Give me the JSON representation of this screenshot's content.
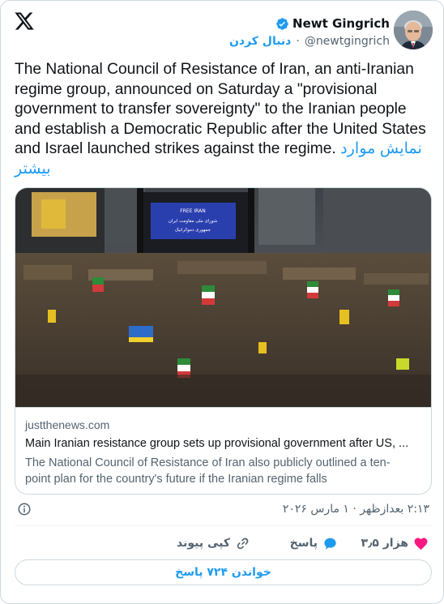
{
  "author": {
    "display_name": "Newt Gingrich",
    "handle": "@newtgingrich",
    "separator": "·",
    "follow_label": "دنبال کردن",
    "verified": true
  },
  "tweet": {
    "text": "The National Council of Resistance of Iran, an anti-Iranian regime group, announced on Saturday a \"provisional government to transfer sovereignty\" to the Iranian people and establish a Democratic Republic after the United States and Israel launched strikes against the regime.",
    "show_more": "نمایش موارد بیشتر"
  },
  "photo": {
    "screen_text_top": "FREE IRAN",
    "screen_text_line1": "شورای ملی مقاومت ایران",
    "screen_text_line2": "جمهوری دموکراتیک"
  },
  "link_card": {
    "domain": "justthenews.com",
    "title": "Main Iranian resistance group sets up provisional government after US, ...",
    "description": "The National Council of Resistance of Iran also publicly outlined a ten-point plan for the country's future if the Iranian regime falls"
  },
  "meta": {
    "timestamp": "۲:۱۳ بعدازظهر · ۱ مارس ۲۰۲۶"
  },
  "actions": {
    "like_count": "۳٫۵ هزار",
    "reply_label": "پاسخ",
    "share_label": "کپی پیوند",
    "read_replies": "خواندن ۷۲۴ پاسخ"
  },
  "colors": {
    "accent": "#1d9bf0",
    "like": "#f91880",
    "secondary_text": "#536471",
    "border": "#cfd9de"
  },
  "icons": {
    "logo": "x-logo-icon",
    "verified": "verified-badge-icon",
    "info": "info-icon",
    "like": "heart-icon",
    "reply": "speech-bubble-icon",
    "share": "link-icon"
  }
}
